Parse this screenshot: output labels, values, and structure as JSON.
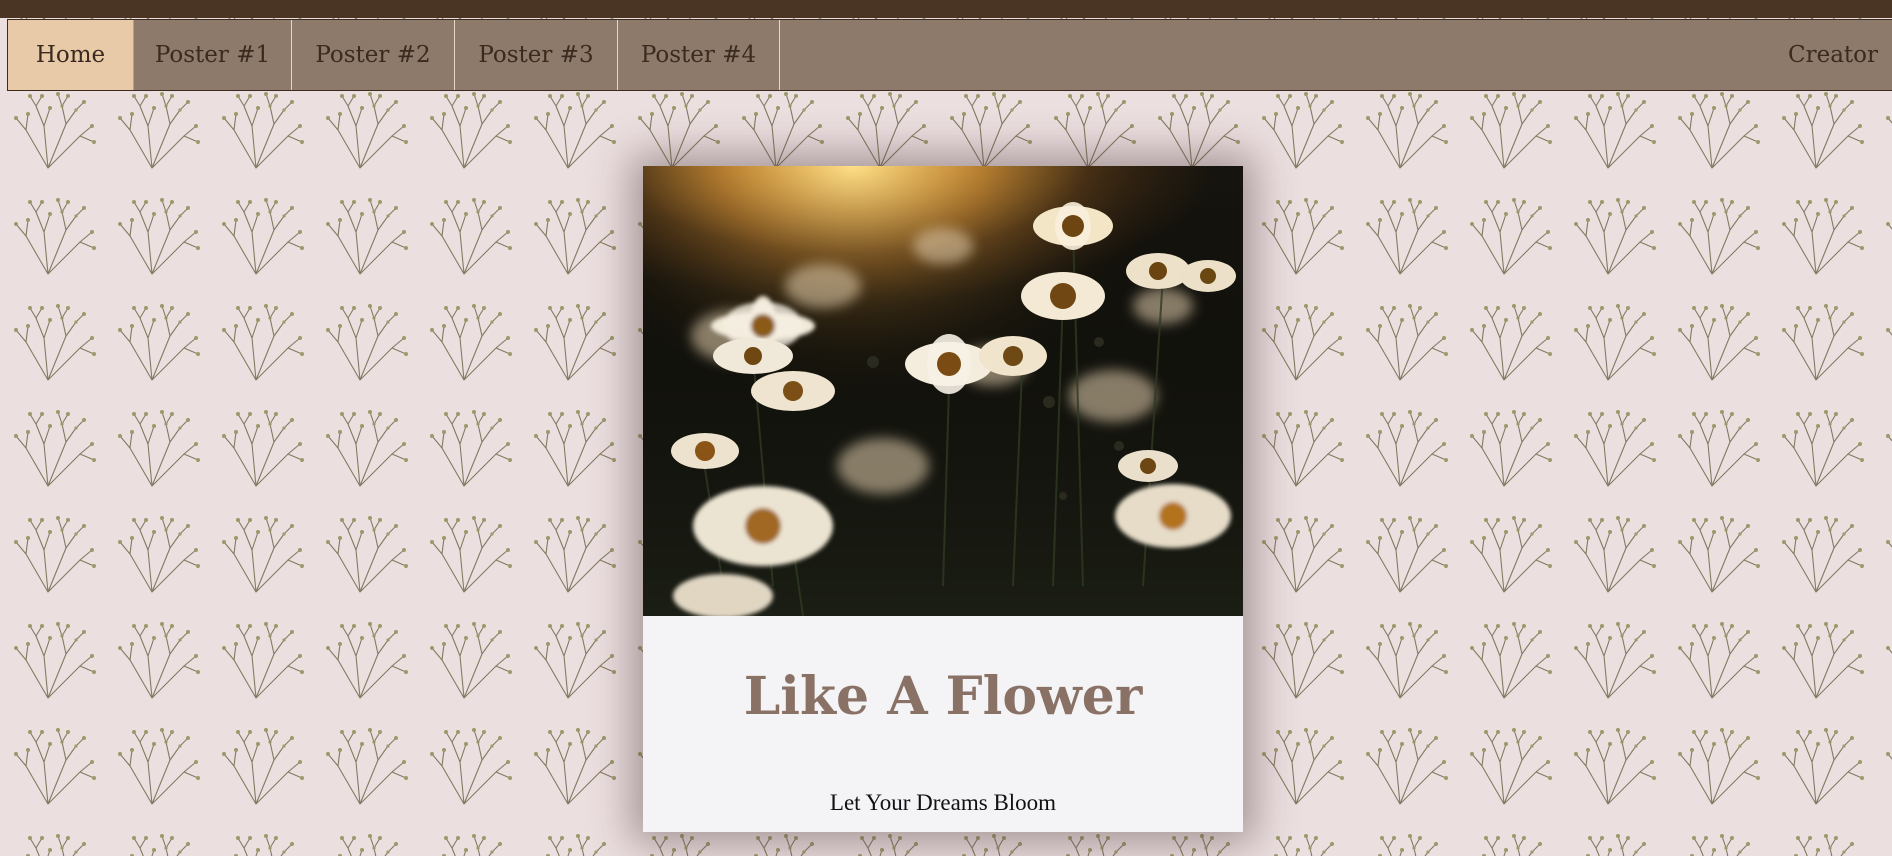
{
  "nav": {
    "items": [
      {
        "label": "Home",
        "active": true
      },
      {
        "label": "Poster #1",
        "active": false
      },
      {
        "label": "Poster #2",
        "active": false
      },
      {
        "label": "Poster #3",
        "active": false
      },
      {
        "label": "Poster #4",
        "active": false
      }
    ],
    "creator_label": "Creator"
  },
  "poster": {
    "title": "Like A Flower",
    "subtitle": "Let Your Dreams Bloom",
    "image_icon": "daisy-field-photo"
  },
  "colors": {
    "topbar": "#4a3524",
    "nav_bg": "#8e7a6a",
    "nav_active": "#e8c9a8",
    "page_bg": "#ecdfe0",
    "title": "#8a7166"
  }
}
